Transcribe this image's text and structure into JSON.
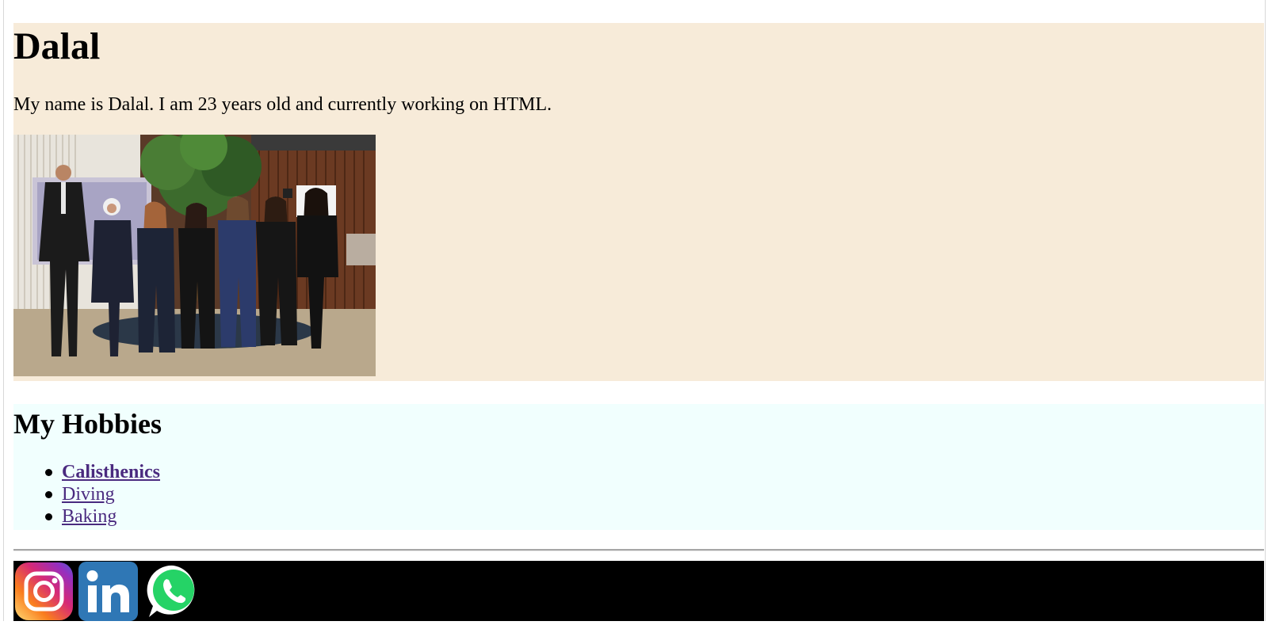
{
  "intro": {
    "title": "Dalal",
    "bio": "My name is Dalal. I am 23 years old and currently working on HTML."
  },
  "hobbies": {
    "heading": "My Hobbies",
    "items": [
      {
        "label": "Calisthenics",
        "bold": true
      },
      {
        "label": "Diving",
        "bold": false
      },
      {
        "label": "Baking",
        "bold": false
      }
    ]
  },
  "footer": {
    "socials": [
      {
        "name": "instagram-icon"
      },
      {
        "name": "linkedin-icon"
      },
      {
        "name": "whatsapp-icon"
      }
    ]
  },
  "colors": {
    "intro_bg": "#f7ebd9",
    "hobbies_bg": "#f1fffe",
    "link": "#4a2a7f",
    "footer_bg": "#000000",
    "linkedin": "#2f77b5",
    "whatsapp": "#25d366"
  }
}
